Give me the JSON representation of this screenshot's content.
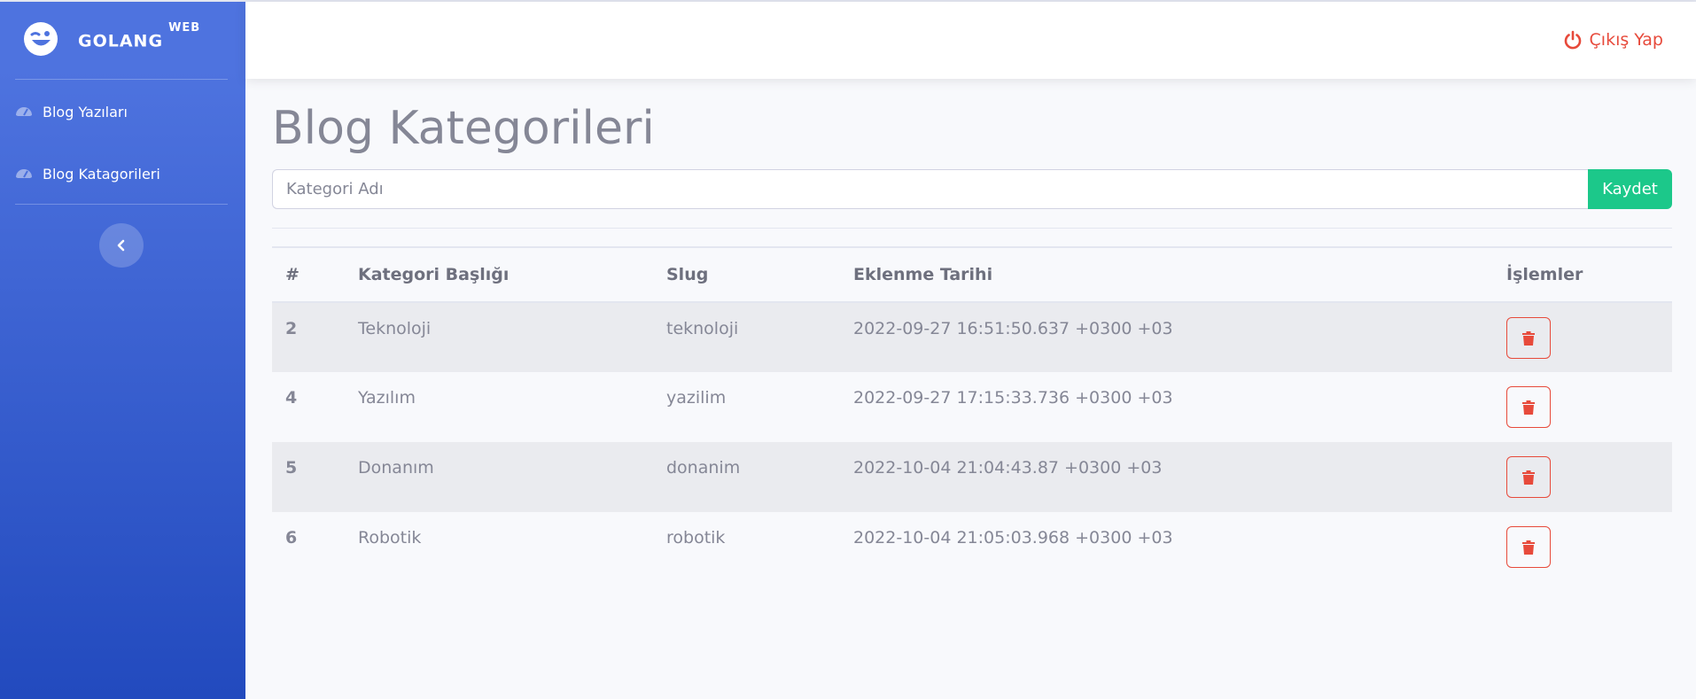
{
  "brand": {
    "name": "GOLANG",
    "sup": "WEB",
    "icon": "winking-face-icon"
  },
  "sidebar": {
    "items": [
      {
        "label": "Blog Yazıları",
        "icon": "tachometer-icon"
      },
      {
        "label": "Blog Katagorileri",
        "icon": "tachometer-icon"
      }
    ],
    "toggle_icon": "chevron-left-icon"
  },
  "topbar": {
    "logout_label": "Çıkış Yap",
    "logout_icon": "power-icon"
  },
  "main": {
    "title": "Blog Kategorileri",
    "form": {
      "placeholder": "Kategori Adı",
      "value": "",
      "save_label": "Kaydet"
    },
    "table": {
      "headers": [
        "#",
        "Kategori Başlığı",
        "Slug",
        "Eklenme Tarihi",
        "İşlemler"
      ],
      "rows": [
        {
          "id": "2",
          "title": "Teknoloji",
          "slug": "teknoloji",
          "date": "2022-09-27 16:51:50.637 +0300 +03"
        },
        {
          "id": "4",
          "title": "Yazılım",
          "slug": "yazilim",
          "date": "2022-09-27 17:15:33.736 +0300 +03"
        },
        {
          "id": "5",
          "title": "Donanım",
          "slug": "donanim",
          "date": "2022-10-04 21:04:43.87 +0300 +03"
        },
        {
          "id": "6",
          "title": "Robotik",
          "slug": "robotik",
          "date": "2022-10-04 21:05:03.968 +0300 +03"
        }
      ],
      "action_icon": "trash-icon"
    }
  },
  "colors": {
    "primary": "#4e73df",
    "primary_dark": "#224abe",
    "success": "#1cc88a",
    "danger": "#e74a3b",
    "text": "#858796",
    "background": "#f8f9fc"
  }
}
